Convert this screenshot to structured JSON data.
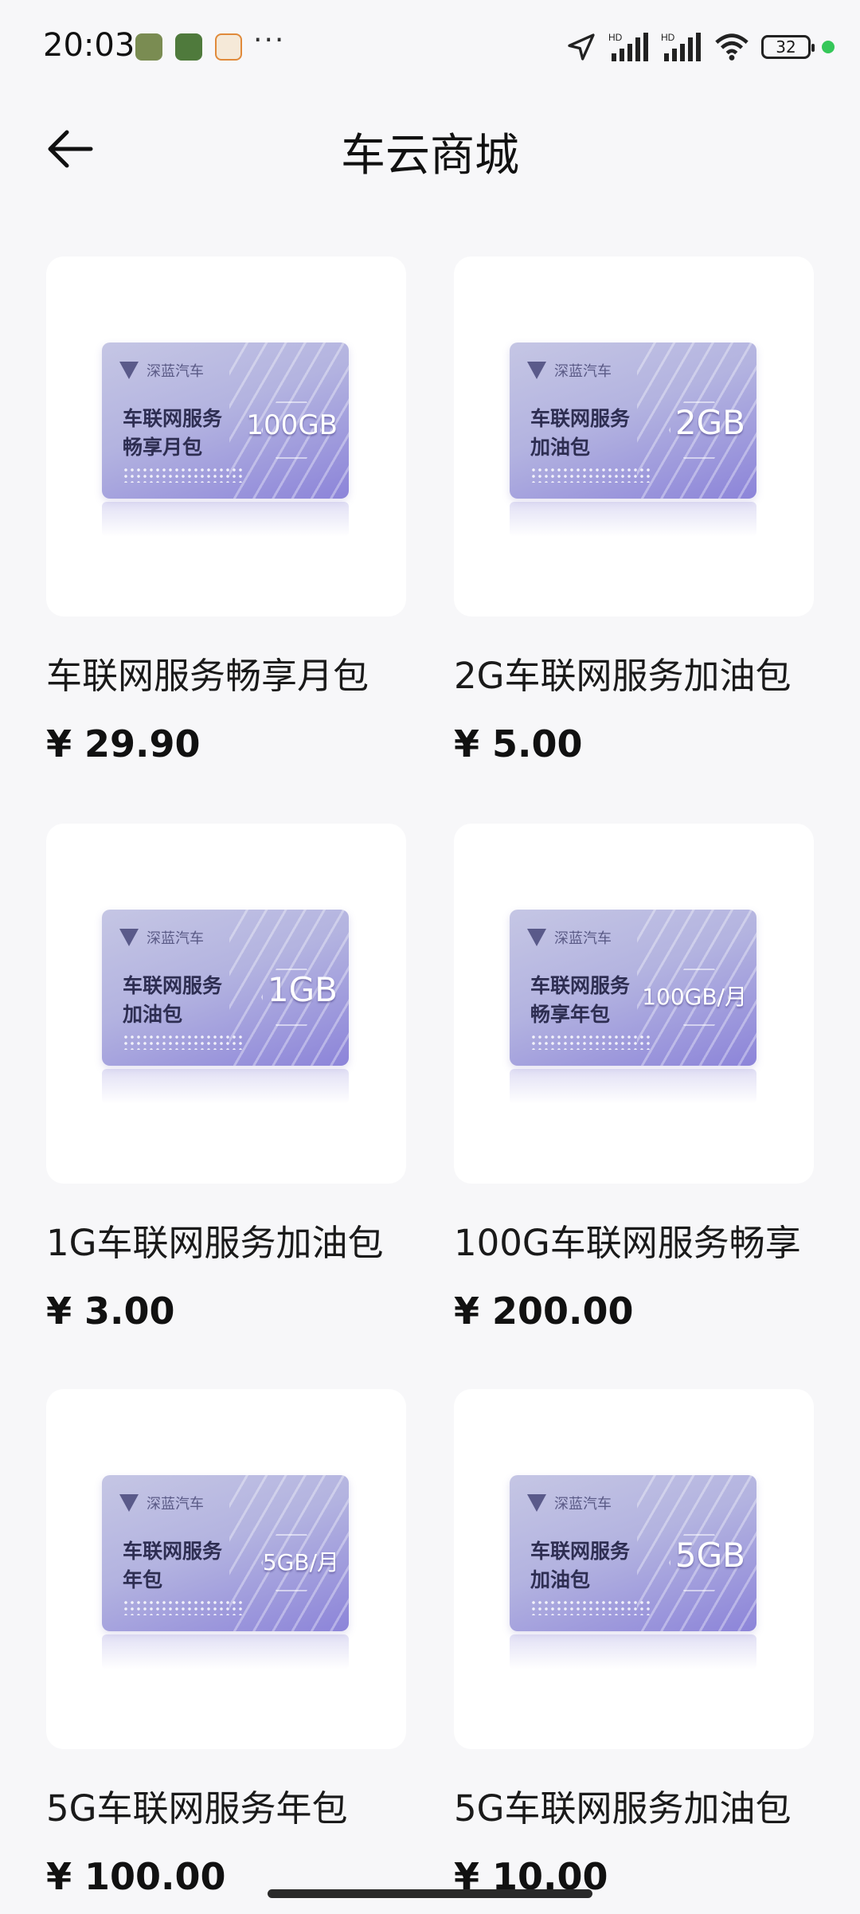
{
  "status_bar": {
    "time": "20:03",
    "more": "···",
    "battery": "32",
    "icons": [
      "wechat-icon",
      "app-icon",
      "app-icon",
      "location-arrow-icon",
      "signal-icon",
      "signal-icon",
      "wifi-icon",
      "battery-icon"
    ]
  },
  "header": {
    "title": "车云商城",
    "back_icon": "arrow-left-icon"
  },
  "sim_brand": "深蓝汽车",
  "products": [
    {
      "name": "车联网服务畅享月包",
      "price": "¥ 29.90",
      "card_line1": "车联网服务",
      "card_line2": "畅享月包",
      "card_big": "100GB",
      "big_style": "mid"
    },
    {
      "name": "2G车联网服务加油包",
      "price": "¥ 5.00",
      "card_line1": "车联网服务",
      "card_line2": "加油包",
      "card_big": "2GB",
      "big_style": ""
    },
    {
      "name": "1G车联网服务加油包",
      "price": "¥ 3.00",
      "card_line1": "车联网服务",
      "card_line2": "加油包",
      "card_big": "1GB",
      "big_style": ""
    },
    {
      "name": "100G车联网服务畅享",
      "price": "¥ 200.00",
      "card_line1": "车联网服务",
      "card_line2": "畅享年包",
      "card_big": "100GB/月",
      "big_style": "small"
    },
    {
      "name": "5G车联网服务年包",
      "price": "¥ 100.00",
      "card_line1": "车联网服务",
      "card_line2": "年包",
      "card_big": "5GB/月",
      "big_style": "small"
    },
    {
      "name": "5G车联网服务加油包",
      "price": "¥ 10.00",
      "card_line1": "车联网服务",
      "card_line2": "加油包",
      "card_big": "5GB",
      "big_style": ""
    }
  ],
  "colors": {
    "background": "#f7f7f9",
    "card": "#ffffff",
    "sim_start": "#c5c6e4",
    "sim_end": "#8c84d9",
    "online_dot": "#35c759"
  }
}
